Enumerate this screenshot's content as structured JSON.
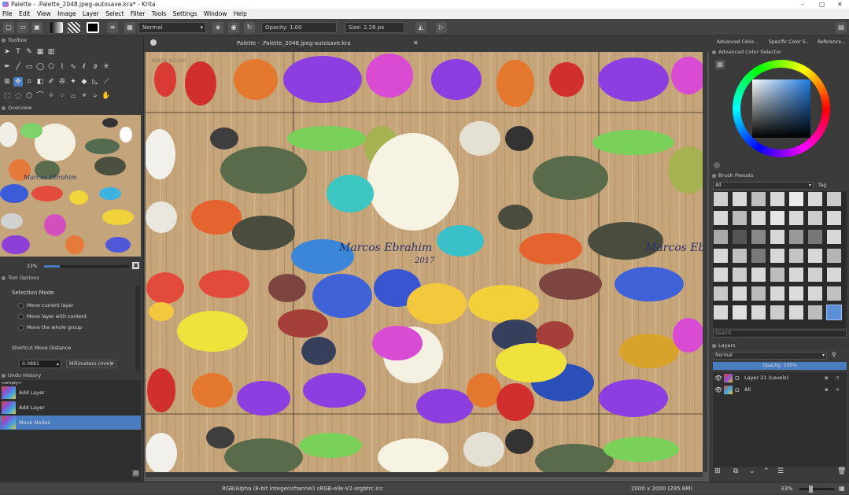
{
  "window": {
    "title": "Palette - .Palette_2048.jpeg-autosave.kra* - Krita",
    "controls": [
      "–",
      "▢",
      "✕"
    ]
  },
  "menu": [
    "File",
    "Edit",
    "View",
    "Image",
    "Layer",
    "Select",
    "Filter",
    "Tools",
    "Settings",
    "Window",
    "Help"
  ],
  "toolbar": {
    "blend_mode": "Normal",
    "opacity": "Opacity: 1.00",
    "size": "Size: 2.26 px"
  },
  "toolbox": {
    "title": "Toolbox"
  },
  "overview": {
    "title": "Overview",
    "zoom": "33%"
  },
  "tool_options": {
    "title": "Tool Options",
    "selection_mode_label": "Selection Mode",
    "options": [
      "Move current layer",
      "Move layer with content",
      "Move the whole group"
    ],
    "shortcut_label": "Shortcut Move Distance",
    "distance_value": "0.0881",
    "unit": "Millimeters (mm)"
  },
  "undo_history": {
    "title": "Undo History",
    "items": [
      "<empty>",
      "Add Layer",
      "Add Layer",
      "Move Nodes"
    ],
    "selected_index": 3
  },
  "document_tab": {
    "title": "Palette - .Palette_2048.jpeg-autosave.kra"
  },
  "canvas": {
    "watermark": "Marcos Ebrahim",
    "year": "2017",
    "corner_tag": "RGB/8 DESIGN"
  },
  "right_tabs": [
    "Advanced Color...",
    "Specific Color S...",
    "Reference..."
  ],
  "color_selector": {
    "title": "Advanced Color Selector"
  },
  "brush_presets": {
    "title": "Brush Presets",
    "filter": "All",
    "tag_label": "Tag",
    "search_placeholder": "Search"
  },
  "layers": {
    "title": "Layers",
    "blend_mode": "Normal",
    "opacity": "Opacity: 100%",
    "items": [
      "Layer 21 (Levels)",
      "All"
    ]
  },
  "status": {
    "color_model": "RGB/Alpha (8-bit integer/channel)  sRGB-elle-V2-srgbtrc.icc",
    "dimensions": "2000 x 2000 (295.8M)",
    "zoom": "33%"
  },
  "colors": {
    "accent": "#4a7cc0",
    "panel_bg": "#3b3b3b",
    "canvas_bg": "#c7a77a"
  }
}
